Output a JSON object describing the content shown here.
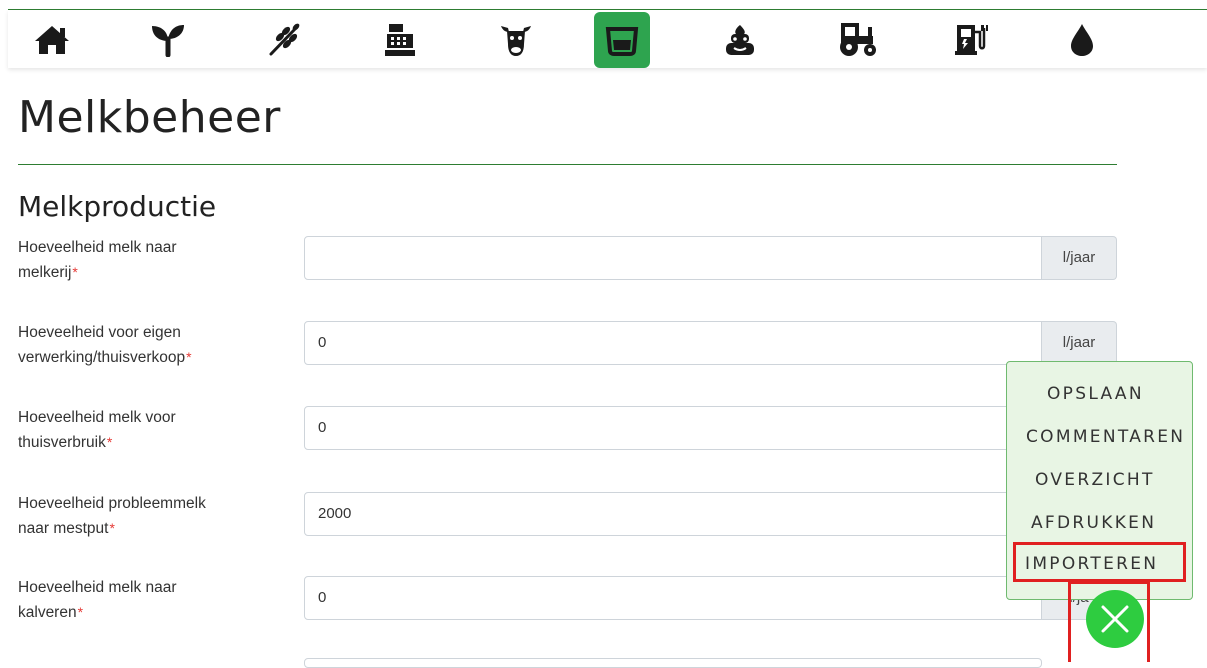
{
  "nav": {
    "icons": [
      {
        "name": "home-icon"
      },
      {
        "name": "sprout-icon"
      },
      {
        "name": "wheat-icon"
      },
      {
        "name": "cash-register-icon"
      },
      {
        "name": "cow-icon"
      },
      {
        "name": "milk-tank-icon",
        "active": true
      },
      {
        "name": "manure-icon"
      },
      {
        "name": "tractor-icon"
      },
      {
        "name": "fuel-pump-icon"
      },
      {
        "name": "water-drop-icon"
      }
    ],
    "active_color": "#2ea44f"
  },
  "page": {
    "title": "Melkbeheer",
    "section_title": "Melkproductie"
  },
  "fields": [
    {
      "label_line1": "Hoeveelheid melk naar",
      "label_line2": "melkerij",
      "value": "",
      "unit": "l/jaar"
    },
    {
      "label_line1": "Hoeveelheid voor eigen",
      "label_line2": "verwerking/thuisverkoop",
      "value": "0",
      "unit": "l/jaar"
    },
    {
      "label_line1": "Hoeveelheid melk voor",
      "label_line2": "thuisverbruik",
      "value": "0",
      "unit": ""
    },
    {
      "label_line1": "Hoeveelheid probleemmelk",
      "label_line2": "naar mestput",
      "value": "2000",
      "unit": ""
    },
    {
      "label_line1": "Hoeveelheid melk naar",
      "label_line2": "kalveren",
      "value": "0",
      "unit": "l/ja"
    }
  ],
  "required_marker": "*",
  "menu": {
    "items": [
      "OPSLAAN",
      "COMMENTAREN",
      "OVERZICHT",
      "AFDRUKKEN",
      "IMPORTEREN"
    ],
    "highlighted": "IMPORTEREN",
    "fab_icon": "close-icon"
  },
  "colors": {
    "accent": "#2e7d32",
    "fab": "#2ecc40",
    "highlight": "#e02020",
    "menu_bg": "#e8f5e4"
  }
}
